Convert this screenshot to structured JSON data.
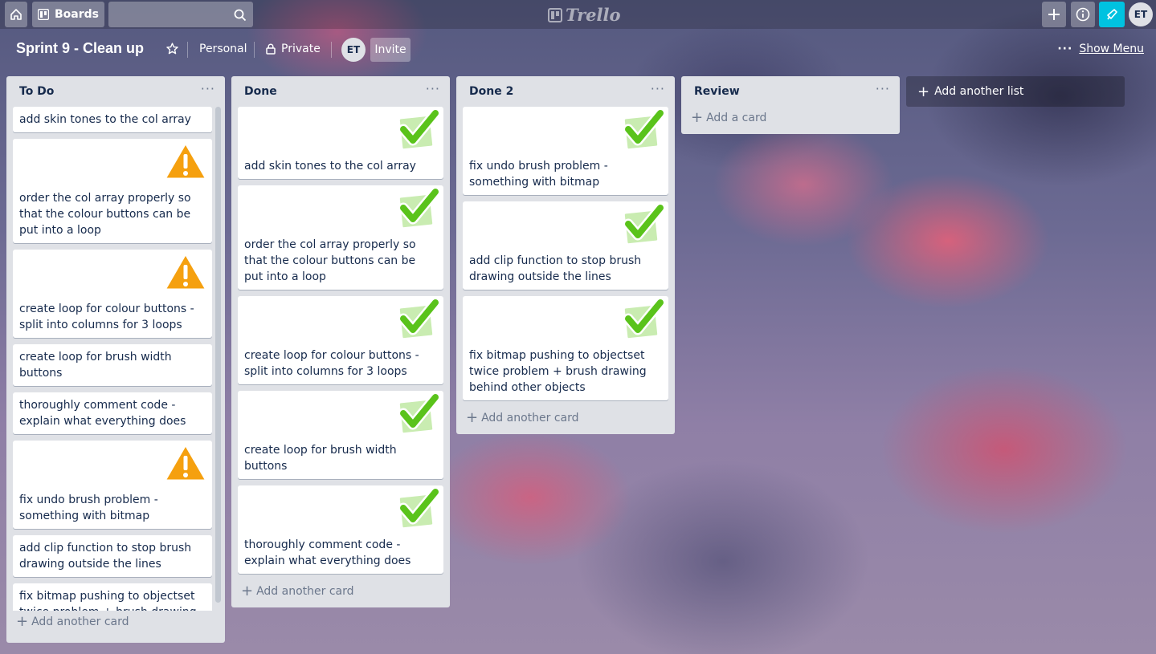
{
  "header": {
    "boards_label": "Boards",
    "logo_text": "Trello",
    "user_initials": "ET"
  },
  "board": {
    "title": "Sprint 9 - Clean up",
    "team": "Personal",
    "visibility": "Private",
    "member_initials": "ET",
    "invite_label": "Invite",
    "show_menu_label": "Show Menu"
  },
  "lists": [
    {
      "title": "To Do",
      "add_label": "Add another card",
      "cards": [
        {
          "text": "add skin tones to the col array",
          "badge": "none"
        },
        {
          "text": "order the col array properly so that the colour buttons can be put into a loop",
          "badge": "warning-icon"
        },
        {
          "text": "create loop for colour buttons - split into columns for 3 loops",
          "badge": "warning-icon"
        },
        {
          "text": "create loop for brush width buttons",
          "badge": "none"
        },
        {
          "text": "thoroughly comment code - explain what everything does",
          "badge": "none"
        },
        {
          "text": "fix undo brush problem - something with bitmap",
          "badge": "warning-icon"
        },
        {
          "text": "add clip function to stop brush drawing outside the lines",
          "badge": "none"
        },
        {
          "text": "fix bitmap pushing to objectset twice problem + brush drawing behind other objects",
          "badge": "none"
        }
      ]
    },
    {
      "title": "Done",
      "add_label": "Add another card",
      "cards": [
        {
          "text": "add skin tones to the col array",
          "badge": "checkmark-icon"
        },
        {
          "text": "order the col array properly so that the colour buttons can be put into a loop",
          "badge": "checkmark-icon"
        },
        {
          "text": "create loop for colour buttons - split into columns for 3 loops",
          "badge": "checkmark-icon"
        },
        {
          "text": "create loop for brush width buttons",
          "badge": "checkmark-icon"
        },
        {
          "text": "thoroughly comment code - explain what everything does",
          "badge": "checkmark-icon"
        }
      ]
    },
    {
      "title": "Done 2",
      "add_label": "Add another card",
      "cards": [
        {
          "text": "fix undo brush problem - something with bitmap",
          "badge": "checkmark-icon"
        },
        {
          "text": "add clip function to stop brush drawing outside the lines",
          "badge": "checkmark-icon"
        },
        {
          "text": "fix bitmap pushing to objectset twice problem + brush drawing behind other objects",
          "badge": "checkmark-icon"
        }
      ]
    },
    {
      "title": "Review",
      "add_label": "Add a card",
      "cards": []
    }
  ],
  "add_list_label": "Add another list",
  "colors": {
    "list_bg": "#dfe1e6",
    "check_green": "#5ac31b",
    "warning_orange": "#f5a00f",
    "notification_accent": "#00c2e0"
  }
}
